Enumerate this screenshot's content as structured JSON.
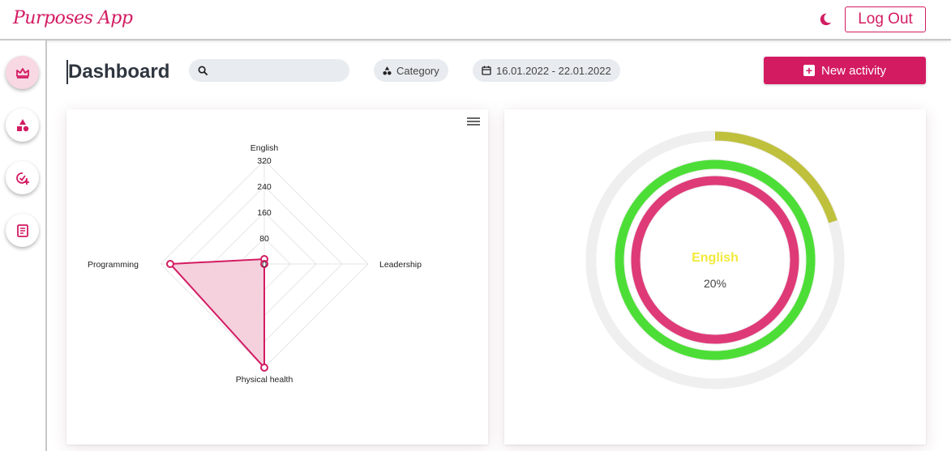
{
  "app": {
    "title": "Purposes App"
  },
  "header": {
    "logout_label": "Log Out",
    "theme_icon": "moon-icon"
  },
  "sidebar": {
    "items": [
      {
        "icon": "crown-icon",
        "active": true
      },
      {
        "icon": "shapes-icon",
        "active": false
      },
      {
        "icon": "check-add-icon",
        "active": false
      },
      {
        "icon": "notes-icon",
        "active": false
      }
    ]
  },
  "toolbar": {
    "title": "Dashboard",
    "search_placeholder": "",
    "category_label": "Category",
    "date_range": "16.01.2022 - 22.01.2022",
    "new_activity_label": "New activity"
  },
  "colors": {
    "accent": "#d31b62",
    "radar_fill": "#f3c9d8",
    "ring_outer": "#bfc03c",
    "ring_middle": "#4cde36",
    "ring_inner": "#df3a78",
    "center_label": "#f2e93a"
  },
  "chart_data": [
    {
      "type": "radar",
      "categories": [
        "English",
        "Leadership",
        "Physical health",
        "Programming"
      ],
      "values": [
        15,
        0,
        320,
        290
      ],
      "scale_ticks": [
        "0",
        "80",
        "160",
        "240",
        "320"
      ],
      "ylim": [
        0,
        320
      ],
      "grid": true
    },
    {
      "type": "radialBar",
      "center_label": "English",
      "center_value": "20%",
      "series_fractions": [
        0.2,
        1.0,
        1.0
      ]
    }
  ]
}
